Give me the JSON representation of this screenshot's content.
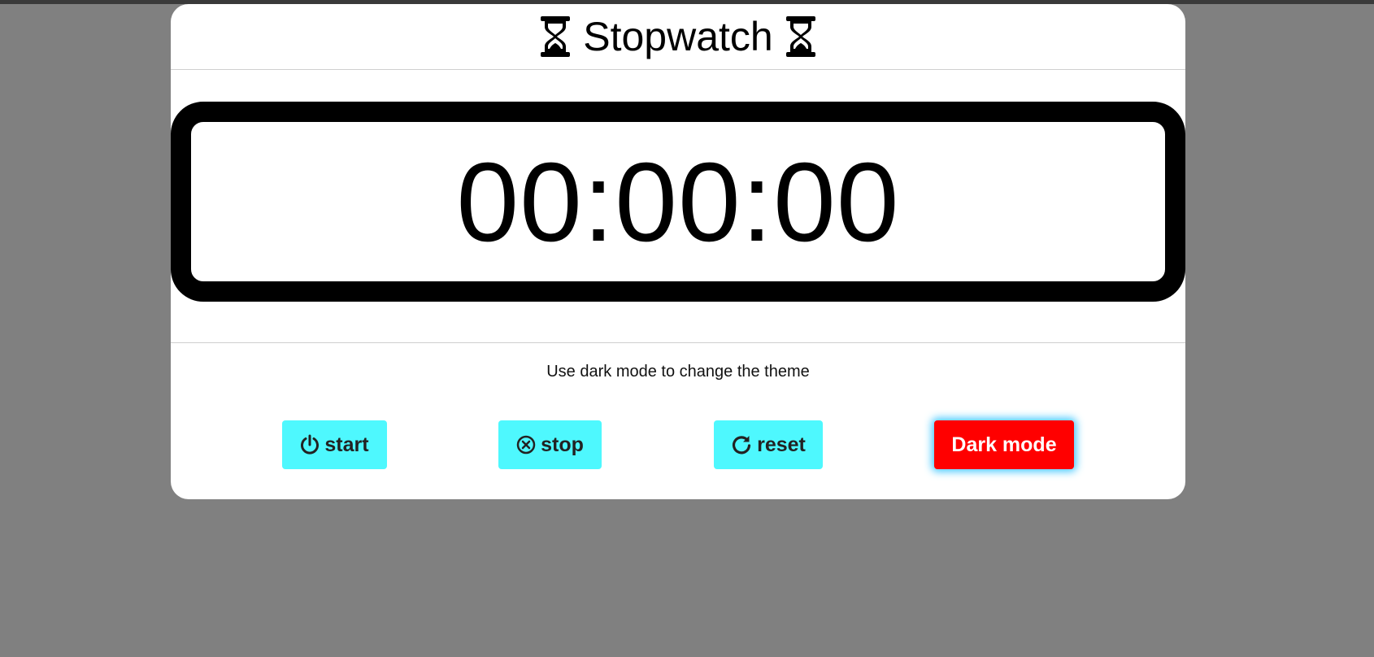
{
  "header": {
    "title": "Stopwatch",
    "left_icon": "hourglass-icon",
    "right_icon": "hourglass-icon"
  },
  "display": {
    "time": "00:00:00"
  },
  "hint": "Use dark mode to change the theme",
  "buttons": {
    "start": {
      "label": "start",
      "icon": "power-icon"
    },
    "stop": {
      "label": "stop",
      "icon": "circle-x-icon"
    },
    "reset": {
      "label": "reset",
      "icon": "rotate-icon"
    },
    "dark_mode": {
      "label": "Dark mode"
    }
  },
  "colors": {
    "page_background": "#808080",
    "card_background": "#ffffff",
    "control_button": "#4ef8fe",
    "dark_mode_button": "#ff0000",
    "dark_mode_glow": "#46c8ff"
  }
}
